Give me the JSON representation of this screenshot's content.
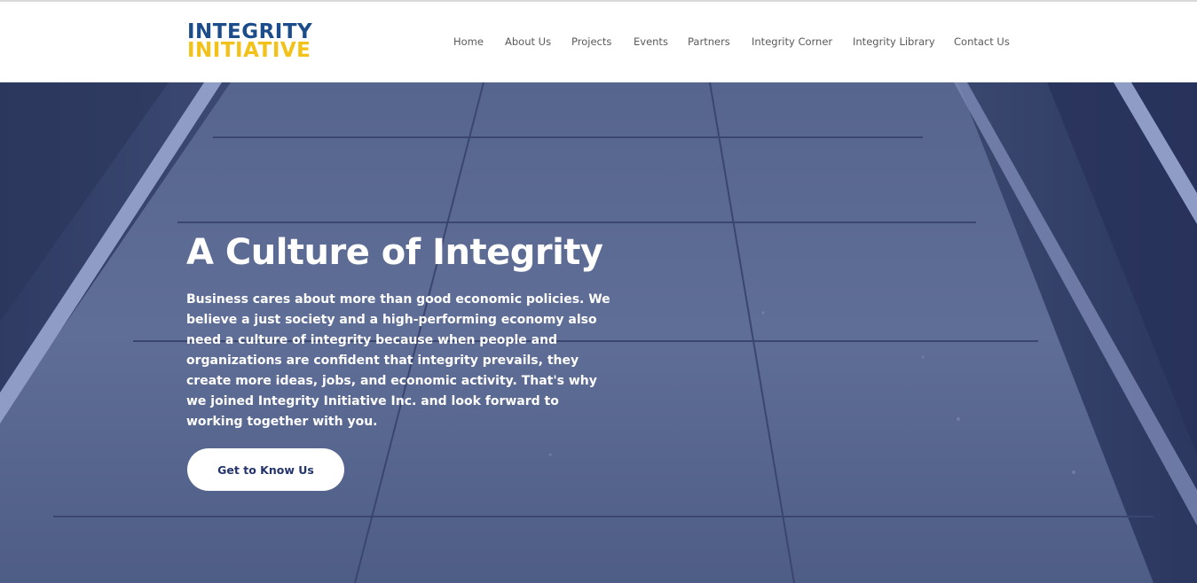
{
  "logo": {
    "line1": "INTEGRITY",
    "line2": "INITIATIVE"
  },
  "nav": {
    "items": [
      {
        "label": "Home"
      },
      {
        "label": "About Us"
      },
      {
        "label": "Projects"
      },
      {
        "label": "Events"
      },
      {
        "label": "Partners"
      },
      {
        "label": "Integrity Corner"
      },
      {
        "label": "Integrity Library"
      },
      {
        "label": "Contact Us"
      }
    ]
  },
  "hero": {
    "title": "A Culture of Integrity",
    "body": "Business cares about more than good economic policies. We believe a just society and a high-performing economy also need a culture of integrity because when people and organizations are confident that integrity prevails, they create more ideas, jobs, and economic activity. That's why we joined Integrity Initiative Inc. and look forward to working together with you.",
    "cta_label": "Get to Know Us"
  },
  "colors": {
    "logo_blue": "#1d4c8a",
    "logo_yellow": "#f2c21a",
    "hero_overlay": "#46557f",
    "cta_text": "#23346b",
    "nav_text": "#5a5a5a"
  }
}
